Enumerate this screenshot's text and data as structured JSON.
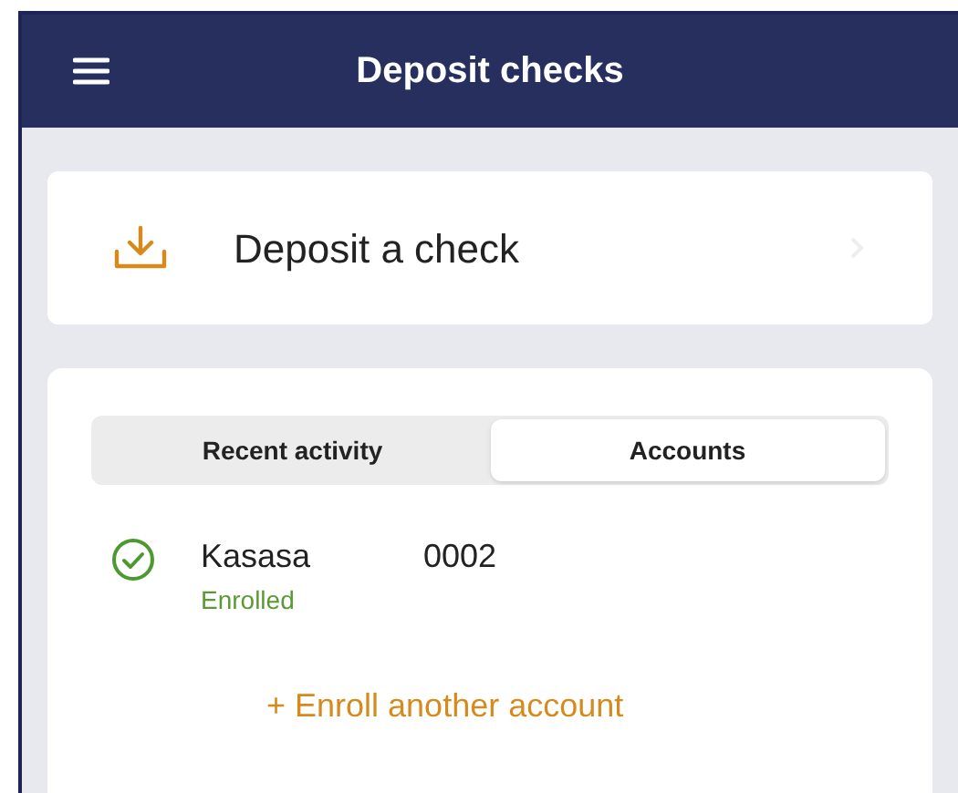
{
  "header": {
    "title": "Deposit checks"
  },
  "deposit_action": {
    "label": "Deposit a check"
  },
  "tabs": [
    {
      "label": "Recent activity",
      "selected": false
    },
    {
      "label": "Accounts",
      "selected": true
    }
  ],
  "accounts": [
    {
      "name": "Kasasa",
      "number": "0002",
      "status": "Enrolled",
      "enrolled": true
    }
  ],
  "enroll_link": "+ Enroll another account"
}
